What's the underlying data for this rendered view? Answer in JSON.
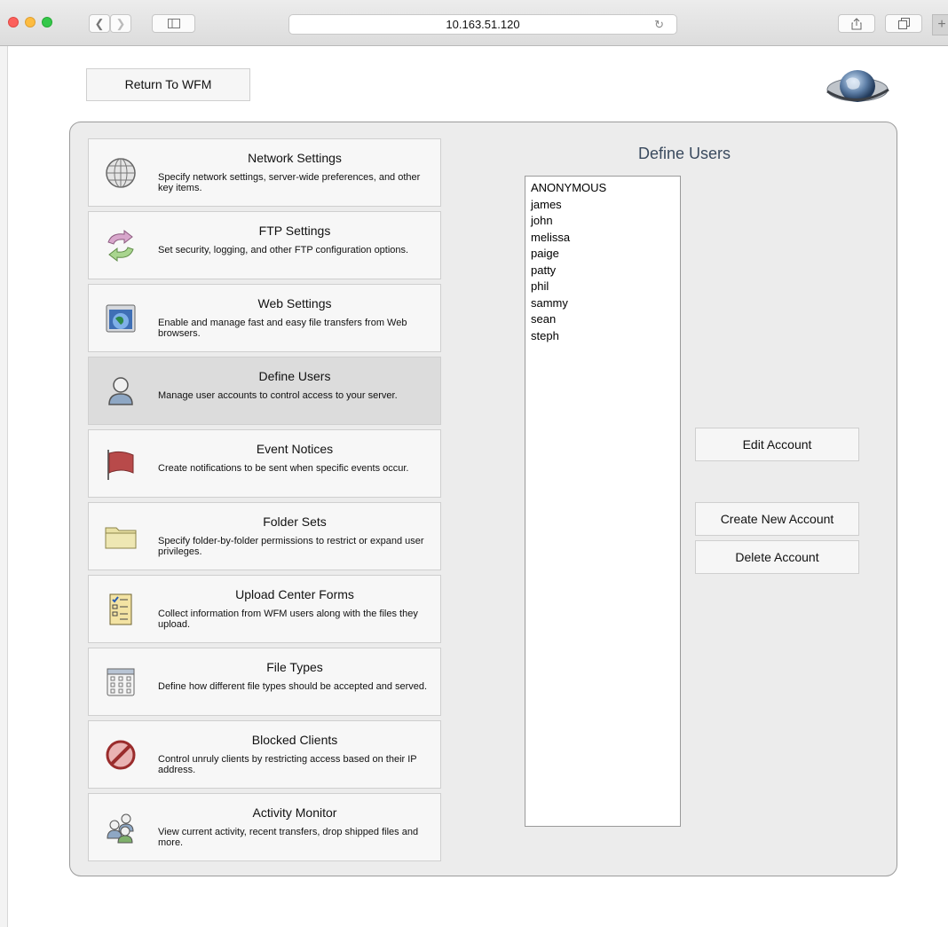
{
  "browser": {
    "url": "10.163.51.120",
    "back_icon": "chevron-left",
    "forward_icon": "chevron-right",
    "sidebar_icon": "sidebar",
    "share_icon": "share",
    "tabs_icon": "tabs",
    "reload_icon": "reload"
  },
  "page": {
    "return_button": "Return To WFM"
  },
  "menu": {
    "items": [
      {
        "title": "Network Settings",
        "desc": "Specify network settings, server-wide preferences, and other key items.",
        "icon": "globe-icon"
      },
      {
        "title": "FTP Settings",
        "desc": "Set security, logging, and other FTP configuration options.",
        "icon": "sync-arrows-icon"
      },
      {
        "title": "Web Settings",
        "desc": "Enable and manage fast and easy file transfers from Web browsers.",
        "icon": "web-window-icon"
      },
      {
        "title": "Define Users",
        "desc": "Manage user accounts to control access to your server.",
        "icon": "user-icon"
      },
      {
        "title": "Event Notices",
        "desc": "Create notifications to be sent when specific events occur.",
        "icon": "flag-icon"
      },
      {
        "title": "Folder Sets",
        "desc": "Specify folder-by-folder permissions to restrict or expand user privileges.",
        "icon": "folder-icon"
      },
      {
        "title": "Upload Center Forms",
        "desc": "Collect information from WFM users along with the files they upload.",
        "icon": "checklist-icon"
      },
      {
        "title": "File Types",
        "desc": "Define how different file types should be accepted and served.",
        "icon": "calendar-grid-icon"
      },
      {
        "title": "Blocked Clients",
        "desc": "Control unruly clients by restricting access based on their IP address.",
        "icon": "blocked-icon"
      },
      {
        "title": "Activity Monitor",
        "desc": "View current activity, recent transfers, drop shipped files and more.",
        "icon": "users-group-icon"
      }
    ],
    "selected": "Define Users"
  },
  "users_panel": {
    "title": "Define Users",
    "users": [
      "ANONYMOUS",
      "james",
      "john",
      "melissa",
      "paige",
      "patty",
      "phil",
      "sammy",
      "sean",
      "steph"
    ],
    "edit_button": "Edit Account",
    "create_button": "Create New Account",
    "delete_button": "Delete Account"
  }
}
